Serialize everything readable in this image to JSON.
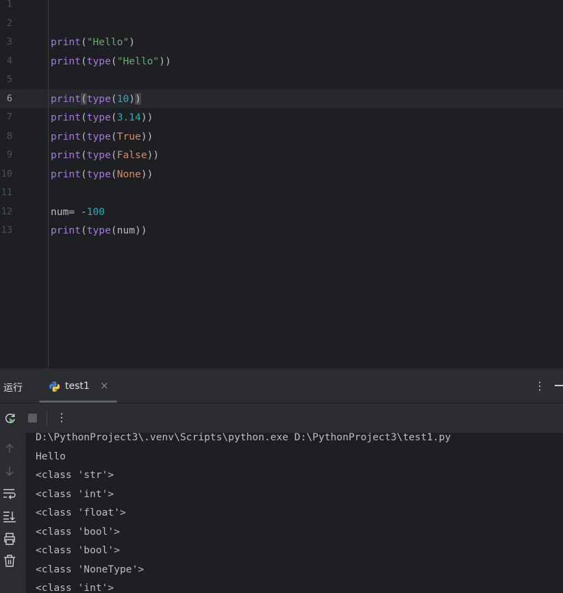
{
  "editor": {
    "line_numbers": [
      "1",
      "2",
      "3",
      "4",
      "5",
      "6",
      "7",
      "8",
      "9",
      "10",
      "11",
      "12",
      "13"
    ],
    "current_line": "6",
    "code": {
      "line3": {
        "fn": "print",
        "open": "(",
        "str": "\"Hello\"",
        "close": ")"
      },
      "line4": {
        "fn": "print",
        "open": "(",
        "fn2": "type",
        "open2": "(",
        "str": "\"Hello\"",
        "close": "))"
      },
      "line6": {
        "fn": "print",
        "open": "(",
        "fn2": "type",
        "open2": "(",
        "num": "10",
        "close1": ")",
        "close2": ")"
      },
      "line7": {
        "fn": "print",
        "open": "(",
        "fn2": "type",
        "open2": "(",
        "num": "3.14",
        "close": "))"
      },
      "line8": {
        "fn": "print",
        "open": "(",
        "fn2": "type",
        "open2": "(",
        "kw": "True",
        "close": "))"
      },
      "line9": {
        "fn": "print",
        "open": "(",
        "fn2": "type",
        "open2": "(",
        "kw": "False",
        "close": "))"
      },
      "line10": {
        "fn": "print",
        "open": "(",
        "fn2": "type",
        "open2": "(",
        "kw": "None",
        "close": "))"
      },
      "line12": {
        "var": "num= -",
        "num": "100"
      },
      "line13": {
        "fn": "print",
        "open": "(",
        "fn2": "type",
        "rest": "(num))"
      }
    }
  },
  "run_panel": {
    "title": "运行",
    "tab_label": "test1",
    "tab_close": "×",
    "more_glyph": "⋮",
    "output": [
      "D:\\PythonProject3\\.venv\\Scripts\\python.exe D:\\PythonProject3\\test1.py",
      "Hello",
      "<class 'str'>",
      "<class 'int'>",
      "<class 'float'>",
      "<class 'bool'>",
      "<class 'bool'>",
      "<class 'NoneType'>",
      "<class 'int'>"
    ]
  },
  "colors": {
    "background": "#1e1f22",
    "panel": "#2b2d30",
    "builtin": "#a57bd9",
    "string": "#6aab73",
    "number": "#2aacb8",
    "keyword": "#cf8e6d"
  },
  "icons": [
    "python-file-icon",
    "rerun-icon",
    "stop-icon",
    "more-icon",
    "minimize-icon",
    "scroll-up-icon",
    "scroll-down-icon",
    "soft-wrap-icon",
    "scroll-to-end-icon",
    "print-icon",
    "trash-icon"
  ]
}
